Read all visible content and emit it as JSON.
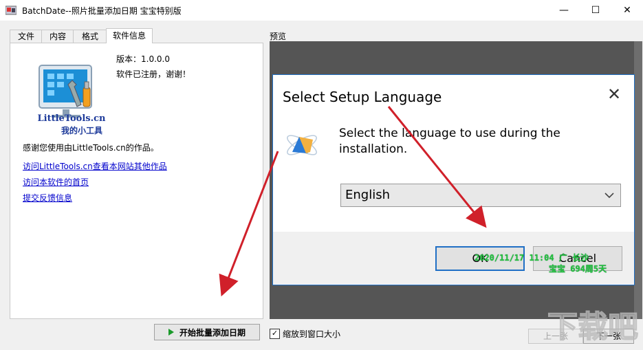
{
  "window": {
    "title": "BatchDate--照片批量添加日期 宝宝特别版",
    "minimize_glyph": "—",
    "maximize_glyph": "☐",
    "close_glyph": "✕"
  },
  "tabs": [
    {
      "label": "文件"
    },
    {
      "label": "内容"
    },
    {
      "label": "格式"
    },
    {
      "label": "软件信息"
    }
  ],
  "info": {
    "logo_text_1": "LittleTools.cn",
    "logo_text_2": "我的小工具",
    "version": "版本：1.0.0.0",
    "registered": "软件已注册，谢谢！",
    "thanks": "感谢您使用由LittleTools.cn的作品。",
    "links": [
      "访问LittleTools.cn查看本网站其他作品",
      "访问本软件的首页",
      "提交反馈信息"
    ]
  },
  "start_button": "开始批量添加日期",
  "preview": {
    "label": "预览",
    "dialog": {
      "title": "Select Setup Language",
      "close_glyph": "✕",
      "message": "Select the language to use during the installation.",
      "selected_language": "English",
      "ok_label": "OK",
      "cancel_label": "Cancel"
    },
    "stamp_line_1": "2020/11/17 11:04 广 长沙",
    "stamp_line_2": "宝宝 694周5天"
  },
  "fit_window": {
    "label": "缩放到窗口大小",
    "checked": true
  },
  "nav": {
    "prev_label": "上一张",
    "next_label": "下一张"
  },
  "watermark_text": "下载吧",
  "colors": {
    "link": "#0000cc",
    "stamp": "#23c23c",
    "arrow": "#d0202a",
    "dialog_border": "#1f6fc5"
  }
}
